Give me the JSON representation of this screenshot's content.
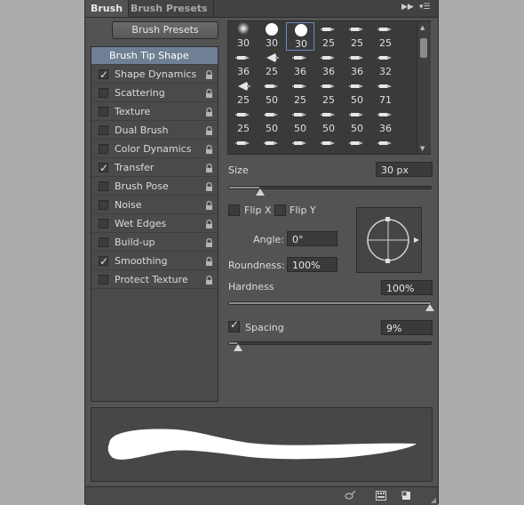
{
  "tabs": {
    "brush": "Brush",
    "brush_presets": "Brush Presets"
  },
  "brush_presets_button": "Brush Presets",
  "options": [
    {
      "label": "Brush Tip Shape",
      "checked": null,
      "locked": false,
      "selected": true
    },
    {
      "label": "Shape Dynamics",
      "checked": true,
      "locked": true,
      "selected": false
    },
    {
      "label": "Scattering",
      "checked": false,
      "locked": true,
      "selected": false
    },
    {
      "label": "Texture",
      "checked": false,
      "locked": true,
      "selected": false
    },
    {
      "label": "Dual Brush",
      "checked": false,
      "locked": true,
      "selected": false
    },
    {
      "label": "Color Dynamics",
      "checked": false,
      "locked": true,
      "selected": false
    },
    {
      "label": "Transfer",
      "checked": true,
      "locked": true,
      "selected": false
    },
    {
      "label": "Brush Pose",
      "checked": false,
      "locked": true,
      "selected": false
    },
    {
      "label": "Noise",
      "checked": false,
      "locked": true,
      "selected": false
    },
    {
      "label": "Wet Edges",
      "checked": false,
      "locked": true,
      "selected": false
    },
    {
      "label": "Build-up",
      "checked": false,
      "locked": true,
      "selected": false
    },
    {
      "label": "Smoothing",
      "checked": true,
      "locked": true,
      "selected": false
    },
    {
      "label": "Protect Texture",
      "checked": false,
      "locked": true,
      "selected": false
    }
  ],
  "brush_tips": [
    {
      "size": "30",
      "icon": "soft-round-brush-icon"
    },
    {
      "size": "30",
      "icon": "hard-round-brush-icon"
    },
    {
      "size": "30",
      "icon": "hard-round-brush-icon"
    },
    {
      "size": "25",
      "icon": "bristle-brush-icon"
    },
    {
      "size": "25",
      "icon": "bristle-brush-icon"
    },
    {
      "size": "25",
      "icon": "bristle-brush-icon"
    },
    {
      "size": "36",
      "icon": "bristle-brush-icon"
    },
    {
      "size": "25",
      "icon": "fan-brush-icon"
    },
    {
      "size": "36",
      "icon": "bristle-brush-icon"
    },
    {
      "size": "36",
      "icon": "bristle-brush-icon"
    },
    {
      "size": "36",
      "icon": "bristle-brush-icon"
    },
    {
      "size": "32",
      "icon": "bristle-brush-icon"
    },
    {
      "size": "25",
      "icon": "fan-brush-icon"
    },
    {
      "size": "50",
      "icon": "bristle-brush-icon"
    },
    {
      "size": "25",
      "icon": "bristle-brush-icon"
    },
    {
      "size": "25",
      "icon": "bristle-brush-icon"
    },
    {
      "size": "50",
      "icon": "bristle-brush-icon"
    },
    {
      "size": "71",
      "icon": "bristle-brush-icon"
    },
    {
      "size": "25",
      "icon": "bristle-brush-icon"
    },
    {
      "size": "50",
      "icon": "bristle-brush-icon"
    },
    {
      "size": "50",
      "icon": "bristle-brush-icon"
    },
    {
      "size": "50",
      "icon": "bristle-brush-icon"
    },
    {
      "size": "50",
      "icon": "bristle-brush-icon"
    },
    {
      "size": "36",
      "icon": "bristle-brush-icon"
    },
    {
      "size": "",
      "icon": "bristle-brush-icon"
    },
    {
      "size": "",
      "icon": "bristle-brush-icon"
    },
    {
      "size": "",
      "icon": "bristle-brush-icon"
    },
    {
      "size": "",
      "icon": "bristle-brush-icon"
    },
    {
      "size": "",
      "icon": "bristle-brush-icon"
    },
    {
      "size": "",
      "icon": "bristle-brush-icon"
    }
  ],
  "selected_tip_index": 2,
  "size": {
    "label": "Size",
    "value": "30 px",
    "level": 0.15
  },
  "flip_x": {
    "label": "Flip X",
    "checked": false
  },
  "flip_y": {
    "label": "Flip Y",
    "checked": false
  },
  "angle": {
    "label": "Angle:",
    "value": "0°"
  },
  "roundness": {
    "label": "Roundness:",
    "value": "100%"
  },
  "hardness": {
    "label": "Hardness",
    "value": "100%",
    "level": 1.0
  },
  "spacing": {
    "label": "Spacing",
    "checked": true,
    "value": "9%",
    "level": 0.04
  },
  "accent": "#6f7f94"
}
